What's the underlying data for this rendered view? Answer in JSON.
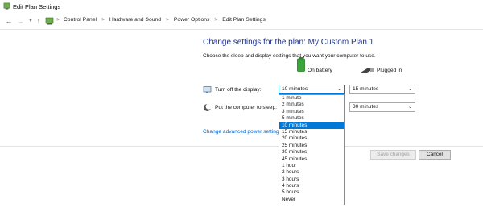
{
  "window": {
    "title": "Edit Plan Settings"
  },
  "nav": {
    "back_icon": "arrow-left-icon",
    "forward_icon": "arrow-right-icon",
    "recent_icon": "chevron-down-icon",
    "up_icon": "arrow-up-icon"
  },
  "breadcrumb": {
    "separator": ">",
    "items": [
      "Control Panel",
      "Hardware and Sound",
      "Power Options",
      "Edit Plan Settings"
    ]
  },
  "main": {
    "title": "Change settings for the plan: My Custom Plan 1",
    "subtitle": "Choose the sleep and display settings that you want your computer to use.",
    "columns": {
      "on_battery": "On battery",
      "plugged_in": "Plugged in"
    },
    "rows": [
      {
        "label": "Turn off the display:",
        "battery_value": "10 minutes",
        "plugged_value": "15 minutes"
      },
      {
        "label": "Put the computer to sleep:",
        "battery_value": "",
        "plugged_value": "30 minutes"
      }
    ],
    "advanced_link": "Change advanced power settings"
  },
  "dropdown": {
    "options": [
      "1 minute",
      "2 minutes",
      "3 minutes",
      "5 minutes",
      "10 minutes",
      "15 minutes",
      "20 minutes",
      "25 minutes",
      "30 minutes",
      "45 minutes",
      "1 hour",
      "2 hours",
      "3 hours",
      "4 hours",
      "5 hours",
      "Never"
    ],
    "selected_index": 4
  },
  "buttons": {
    "save": "Save changes",
    "cancel": "Cancel"
  },
  "colors": {
    "title": "#1e3287",
    "link": "#0066cc",
    "selection": "#0078d7"
  }
}
